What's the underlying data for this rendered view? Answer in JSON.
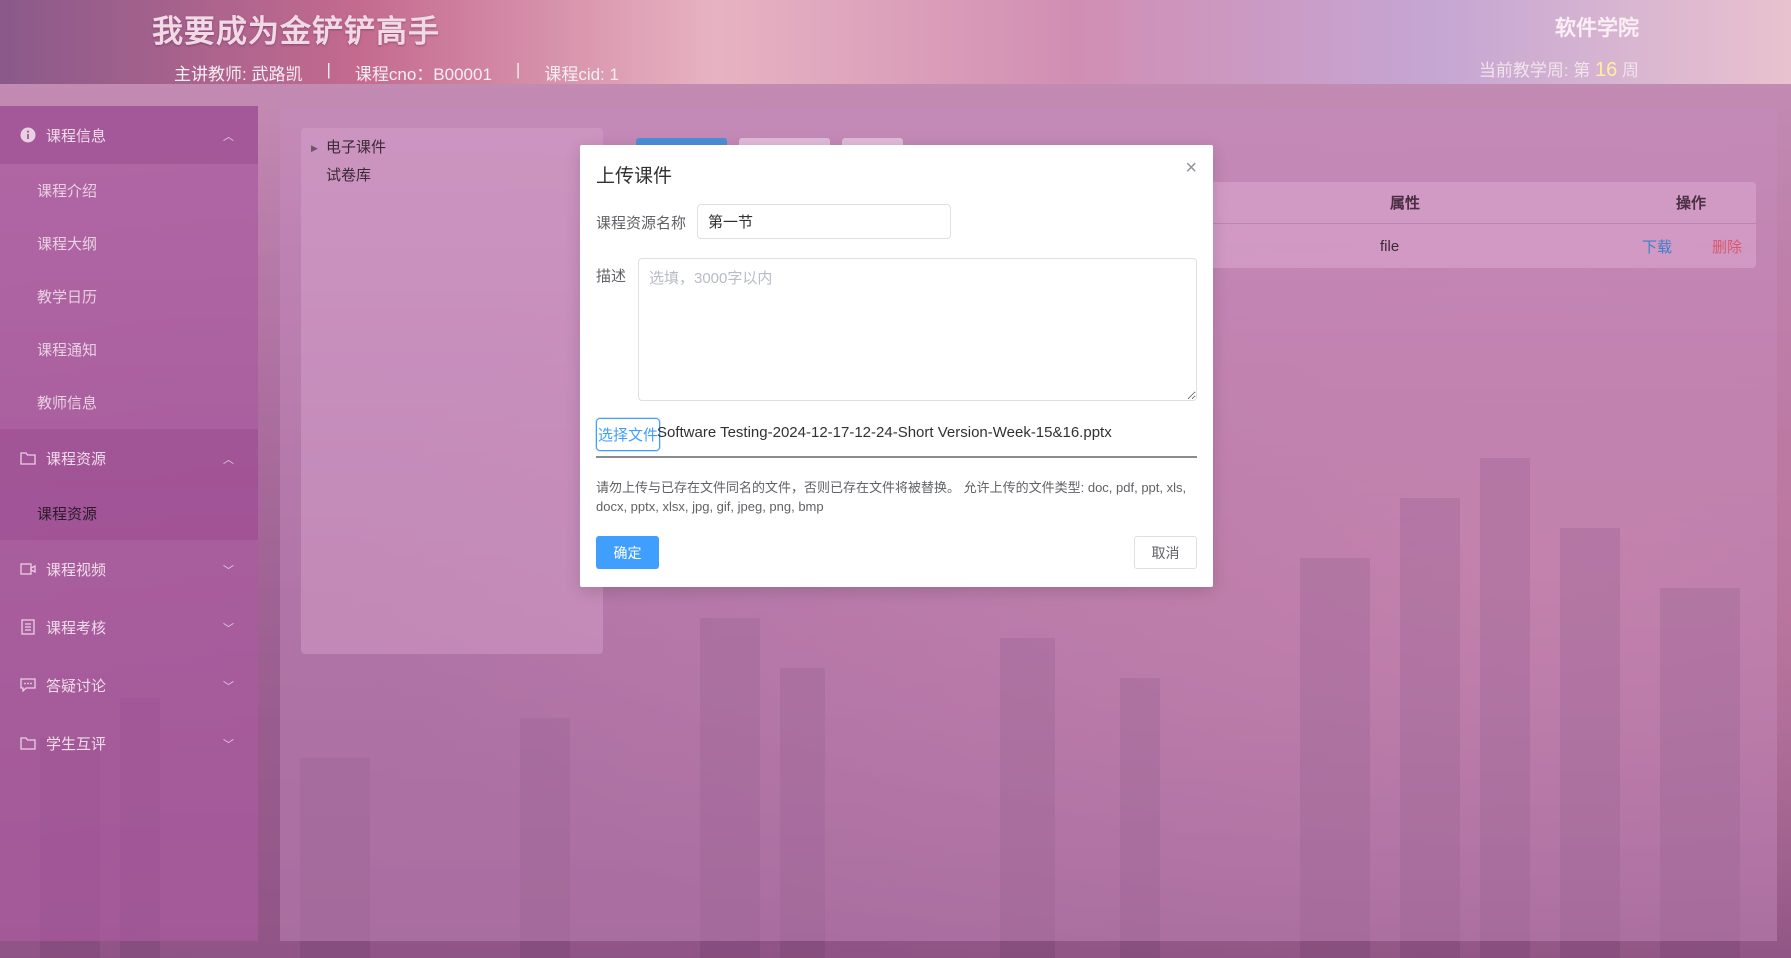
{
  "header": {
    "site_title": "我要成为金铲铲高手",
    "teacher": "主讲教师: 武路凯",
    "cno": "课程cno：B00001",
    "cid": "课程cid: 1",
    "separator": "|",
    "school": "软件学院",
    "week_prefix": "当前教学周: 第",
    "week_number": "16",
    "week_suffix": "周"
  },
  "sidebar": {
    "groups": [
      {
        "label": "课程信息",
        "icon": "info-icon",
        "items": [
          "课程介绍",
          "课程大纲",
          "教学日历",
          "课程通知",
          "教师信息"
        ]
      },
      {
        "label": "课程资源",
        "icon": "folder-icon",
        "items": [
          "课程资源"
        ]
      },
      {
        "label": "课程视频",
        "icon": "video-icon",
        "items": []
      },
      {
        "label": "课程考核",
        "icon": "document-icon",
        "items": []
      },
      {
        "label": "答疑讨论",
        "icon": "chat-icon",
        "items": []
      },
      {
        "label": "学生互评",
        "icon": "folder-icon",
        "items": []
      }
    ]
  },
  "tree": {
    "nodes": [
      "电子课件",
      "试卷库"
    ]
  },
  "table": {
    "headers": {
      "attr": "属性",
      "op": "操作"
    },
    "rows": [
      {
        "attr": "file",
        "download": "下载",
        "delete": "删除"
      }
    ]
  },
  "dialog": {
    "title": "上传课件",
    "close": "×",
    "name_label": "课程资源名称",
    "name_value": "第一节",
    "desc_label": "描述",
    "desc_placeholder": "选填，3000字以内",
    "choose_file": "选择文件",
    "file_name": "Software Testing-2024-12-17-12-24-Short Version-Week-15&16.pptx",
    "tip": "请勿上传与已存在文件同名的文件，否则已存在文件将被替换。 允许上传的文件类型: doc, pdf, ppt, xls, docx, pptx, xlsx, jpg, gif, jpeg, png, bmp",
    "ok": "确定",
    "cancel": "取消"
  },
  "colors": {
    "primary": "#409eff",
    "danger": "#d85a6a",
    "sidebar": "#aa5aa0"
  }
}
